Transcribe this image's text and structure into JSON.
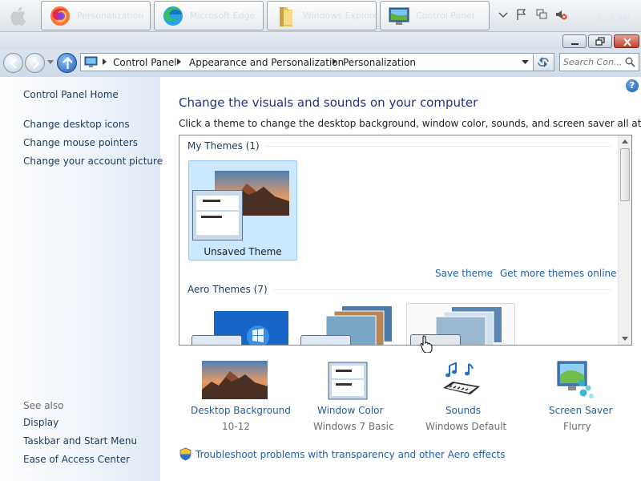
{
  "taskbar": {
    "buttons": [
      {
        "label": "Personalization",
        "icon": "firefox-icon"
      },
      {
        "label": "Microsoft Edge",
        "icon": "edge-icon"
      },
      {
        "label": "Windows Explorer",
        "icon": "folder-icon"
      },
      {
        "label": "Control Panel",
        "icon": "control-panel-icon"
      }
    ],
    "clock": "2:14 AM"
  },
  "address": {
    "crumbs": [
      "Control Panel",
      "Appearance and Personalization",
      "Personalization"
    ],
    "search_placeholder": "Search Con..."
  },
  "sidebar": {
    "home": "Control Panel Home",
    "links": [
      "Change desktop icons",
      "Change mouse pointers",
      "Change your account picture"
    ],
    "see_also_label": "See also",
    "see_also": [
      "Display",
      "Taskbar and Start Menu",
      "Ease of Access Center"
    ]
  },
  "main": {
    "heading": "Change the visuals and sounds on your computer",
    "subtitle": "Click a theme to change the desktop background, window color, sounds, and screen saver all at once.",
    "my_themes_header": "My Themes (1)",
    "unsaved_theme": "Unsaved Theme",
    "save_theme": "Save theme",
    "get_more_themes": "Get more themes online",
    "aero_themes_header": "Aero Themes (7)"
  },
  "bottom": {
    "desktop_background": {
      "label": "Desktop Background",
      "value": "10-12"
    },
    "window_color": {
      "label": "Window Color",
      "value": "Windows 7 Basic"
    },
    "sounds": {
      "label": "Sounds",
      "value": "Windows Default"
    },
    "screen_saver": {
      "label": "Screen Saver",
      "value": "Flurry"
    },
    "troubleshoot": "Troubleshoot problems with transparency and other Aero effects"
  },
  "colors": {
    "link": "#1e5fa8",
    "heading": "#1e3287",
    "selected_tile": "#cce8ff"
  }
}
